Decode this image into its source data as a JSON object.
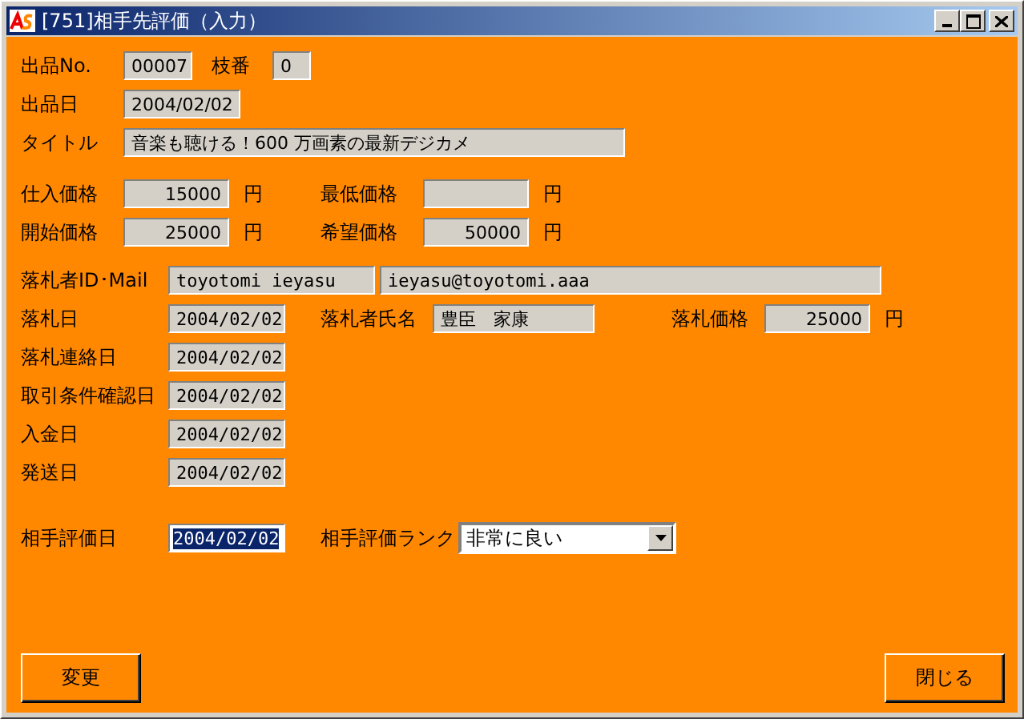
{
  "window": {
    "title": "[751]相手先評価（入力）"
  },
  "listing": {
    "no_label": "出品No.",
    "no": "00007",
    "branch_label": "枝番",
    "branch": "0",
    "date_label": "出品日",
    "date": "2004/02/02",
    "title_label": "タイトル",
    "title": "音楽も聴ける！600 万画素の最新デジカメ"
  },
  "prices": [
    [
      {
        "label": "仕入価格",
        "value": "15000",
        "unit": "円"
      },
      {
        "label": "最低価格",
        "unit": "円"
      }
    ],
    [
      {
        "label": "開始価格",
        "value": "25000",
        "unit": "円"
      },
      {
        "label": "希望価格",
        "value": "50000",
        "unit": "円"
      }
    ]
  ],
  "winner": {
    "id_label": "落札者ID･Mail",
    "id": "toyotomi ieyasu",
    "mail": "ieyasu@toyotomi.aaa",
    "date_label": "落札日",
    "date": "2004/02/02",
    "name_label": "落札者氏名",
    "name": "豊臣　家康",
    "price_label": "落札価格",
    "price": "25000",
    "price_unit": "円"
  },
  "dates": [
    {
      "label": "落札連絡日",
      "value": "2004/02/02"
    },
    {
      "label": "取引条件確認日",
      "value": "2004/02/02"
    },
    {
      "label": "入金日",
      "value": "2004/02/02"
    },
    {
      "label": "発送日",
      "value": "2004/02/02"
    }
  ],
  "evaluation": {
    "date_label": "相手評価日",
    "date": "2004/02/02",
    "date_selected": true,
    "rank_label": "相手評価ランク",
    "rank": "非常に良い"
  },
  "buttons": [
    {
      "label": "変更"
    },
    {
      "label": "閉じる"
    }
  ]
}
